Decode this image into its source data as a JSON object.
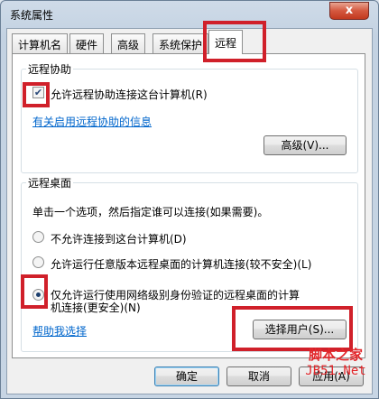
{
  "window": {
    "title": "系统属性",
    "close_glyph": "x"
  },
  "tabs": [
    {
      "label": "计算机名"
    },
    {
      "label": "硬件"
    },
    {
      "label": "高级"
    },
    {
      "label": "系统保护"
    },
    {
      "label": "远程",
      "active": true
    }
  ],
  "remote_assistance": {
    "legend": "远程协助",
    "allow_checkbox_label": "允许远程协助连接这台计算机(R)",
    "allow_checked": true,
    "info_link": "有关启用远程协助的信息",
    "advanced_button": "高级(V)..."
  },
  "remote_desktop": {
    "legend": "远程桌面",
    "instruction": "单击一个选项，然后指定谁可以连接(如果需要)。",
    "options": [
      {
        "label": "不允许连接到这台计算机(D)",
        "selected": false
      },
      {
        "label": "允许运行任意版本远程桌面的计算机连接(较不安全)(L)",
        "selected": false
      },
      {
        "label_line1": "仅允许运行使用网络级别身份验证的远程桌面的计算",
        "label_line2": "机连接(更安全)(N)",
        "selected": true
      }
    ],
    "help_link": "帮助我选择",
    "select_users_button": "选择用户(S)..."
  },
  "footer": {
    "ok_button": "确定",
    "cancel_button": "取消",
    "apply_button": "应用(A)"
  },
  "watermark": {
    "line1": "脚本之家",
    "line2": "JB51.Net"
  },
  "colors": {
    "highlight_box": "#d0202a",
    "link": "#0066cc",
    "watermark": "#e2262a"
  }
}
